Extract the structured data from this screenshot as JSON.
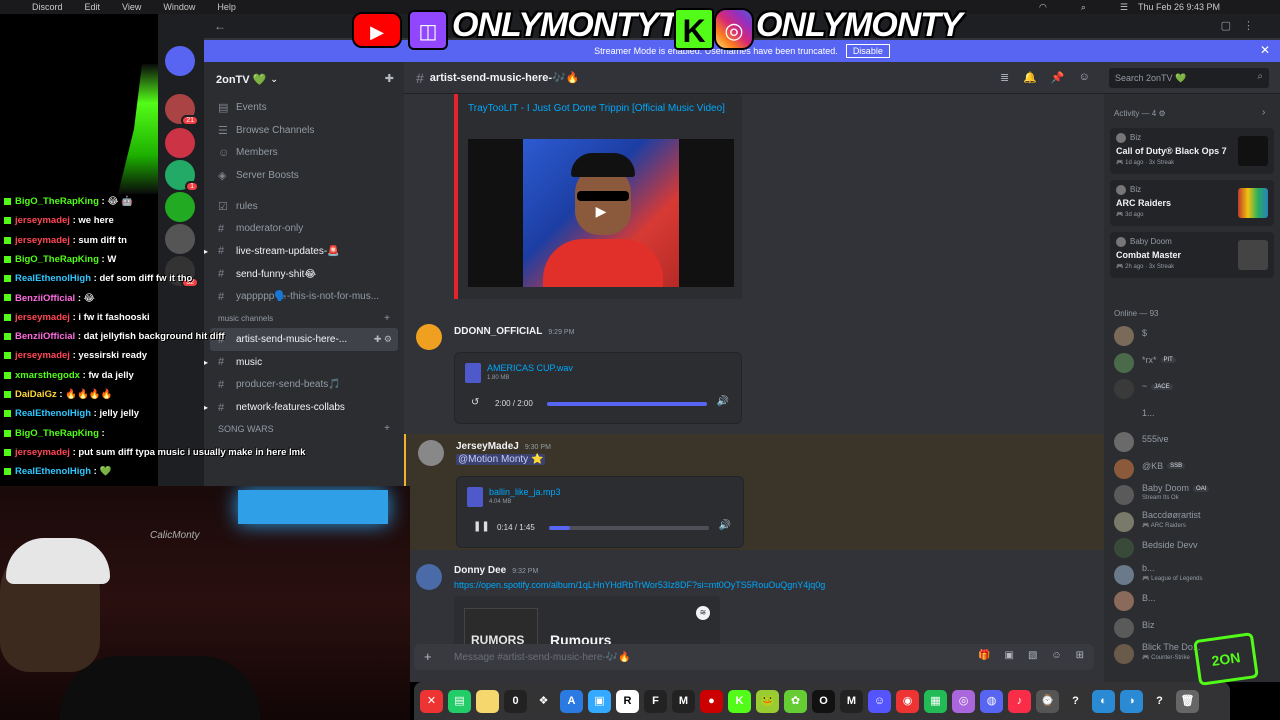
{
  "menubar": {
    "items": [
      "Discord",
      "Edit",
      "View",
      "Window",
      "Help"
    ],
    "clock": "Thu Feb 26  9:43 PM"
  },
  "banner": {
    "text": "Streamer Mode is enabled. Usernames have been truncated.",
    "disable_label": "Disable"
  },
  "server": {
    "name": "2onTV 💚",
    "rail_badges": [
      "21",
      "1",
      "32"
    ]
  },
  "sidebar": {
    "top_items": [
      {
        "label": "Events",
        "icon": "calendar-icon"
      },
      {
        "label": "Browse Channels",
        "icon": "browse-icon"
      },
      {
        "label": "Members",
        "icon": "members-icon"
      },
      {
        "label": "Server Boosts",
        "icon": "boost-icon"
      }
    ],
    "channels": [
      {
        "label": "rules",
        "state": "muted"
      },
      {
        "label": "moderator-only",
        "state": "muted"
      },
      {
        "label": "live-stream-updates-🚨",
        "state": "unread"
      },
      {
        "label": "send-funny-shit😂",
        "state": "unread"
      },
      {
        "label": "yappppp🗣️-this-is-not-for-mus...",
        "state": "muted"
      }
    ],
    "category_label": "music channels",
    "channels2": [
      {
        "label": "artist-send-music-here-...",
        "state": "active"
      },
      {
        "label": "music",
        "state": "unread"
      },
      {
        "label": "producer-send-beats🎵",
        "state": "muted"
      },
      {
        "label": "network-features-collabs",
        "state": "unread"
      }
    ],
    "bottom_label": "SONG WARS"
  },
  "channel_header": {
    "title": "artist-send-music-here-🎶🔥",
    "search_placeholder": "Search 2onTV 💚"
  },
  "messages": {
    "embed": {
      "title": "TrayTooLIT - I Just Got Done Trippin [Official Music Video]"
    },
    "msg1": {
      "author": "DDONN_OFFICIAL",
      "time": "9:29 PM",
      "file": "AMERICAS CUP.wav",
      "size": "1.80 MB",
      "duration": "2:00 / 2:00",
      "progress": 1.0
    },
    "msg2": {
      "author": "JerseyMadeJ",
      "time": "9:30 PM",
      "mention": "@Motion Monty ⭐",
      "file": "ballin_like_ja.mp3",
      "size": "4.04 MB",
      "duration": "0:14 / 1:45",
      "progress": 0.13
    },
    "msg3": {
      "author": "Donny Dee",
      "time": "9:32 PM",
      "link": "https://open.spotify.com/album/1qLHnYHdRbTrWor53Iz8DF?si=mt0OyTS5RouOuQgnY4jq0g",
      "album_art_text": "RUMORS",
      "album_title": "Rumours"
    }
  },
  "composer": {
    "placeholder": "Message #artist-send-music-here-🎶🔥"
  },
  "activity": {
    "header": "Activity — 4",
    "cards": [
      {
        "who": "Biz",
        "game": "Call of Duty® Black Ops 7",
        "meta": "🎮 1d ago · 3x Streak",
        "art_color": "#111111"
      },
      {
        "who": "Biz",
        "game": "ARC Raiders",
        "meta": "🎮 3d ago",
        "art_color": "#c0392b"
      },
      {
        "who": "Baby Doom",
        "game": "Combat Master",
        "meta": "🎮 2h ago · 3x Streak",
        "art_color": "#444444"
      }
    ]
  },
  "online": {
    "header": "Online — 93",
    "members": [
      {
        "name": "$",
        "sub": "",
        "tag": "",
        "color": "#7a6a5a"
      },
      {
        "name": "*rx*",
        "sub": "",
        "tag": "PIT",
        "color": "#4a6a4a"
      },
      {
        "name": "~",
        "sub": "",
        "tag": "JACE",
        "color": "#3a3a3a"
      },
      {
        "name": "1...",
        "sub": "",
        "tag": "",
        "color": "#2b2d31"
      },
      {
        "name": "555ive",
        "sub": "",
        "tag": "",
        "color": "#6a6a6a"
      },
      {
        "name": "@KB",
        "sub": "",
        "tag": "SSB",
        "color": "#8a5a3a"
      },
      {
        "name": "Baby Doom",
        "sub": "Stream Its Ok",
        "tag": "OAI",
        "color": "#5a5a5a"
      },
      {
        "name": "Baccdøøṛartist",
        "sub": "🎮 ARC Raiders",
        "tag": "",
        "color": "#7a7a6a"
      },
      {
        "name": "Bedside Devv",
        "sub": "",
        "tag": "",
        "color": "#3a4a3a"
      },
      {
        "name": "b...",
        "sub": "🎮 League of Legends",
        "tag": "",
        "color": "#6a7a8a"
      },
      {
        "name": "B...",
        "sub": "",
        "tag": "",
        "color": "#8a6a5a"
      },
      {
        "name": "Biz",
        "sub": "",
        "tag": "",
        "color": "#5a5a5a"
      },
      {
        "name": "Blick The Do...",
        "sub": "🎮 Counter-Strike",
        "tag": "",
        "color": "#6a5a4a"
      }
    ]
  },
  "stream_chat": [
    {
      "user": "BigO_TheRapKing",
      "text": ": 😂 🤖",
      "color": "green"
    },
    {
      "user": "jerseymadej",
      "text": ": we here",
      "color": "red"
    },
    {
      "user": "jerseymadej",
      "text": ": sum diff tn",
      "color": "red"
    },
    {
      "user": "BigO_TheRapKing",
      "text": ": W",
      "color": "green"
    },
    {
      "user": "RealEthenolHigh",
      "text": ": def som diff fw it tho",
      "color": "cyan"
    },
    {
      "user": "BenziiOfficial",
      "text": ": 😂",
      "color": "pink"
    },
    {
      "user": "jerseymadej",
      "text": ": i fw it fashooski",
      "color": "red"
    },
    {
      "user": "BenziiOfficial",
      "text": ": dat jellyfish background hit diff",
      "color": "pink"
    },
    {
      "user": "jerseymadej",
      "text": ": yessirski ready",
      "color": "red"
    },
    {
      "user": "xmarsthegodx",
      "text": ": fw da jelly",
      "color": "green"
    },
    {
      "user": "DaiDaiGz",
      "text": ": 🔥🔥🔥🔥",
      "color": "yellow"
    },
    {
      "user": "RealEthenolHigh",
      "text": ": jelly jelly",
      "color": "cyan"
    },
    {
      "user": "BigO_TheRapKing",
      "text": ":",
      "color": "green"
    },
    {
      "user": "jerseymadej",
      "text": ": put sum diff typa music i usually make in here lmk",
      "color": "red"
    },
    {
      "user": "RealEthenolHigh",
      "text": ": 💚",
      "color": "cyan"
    }
  ],
  "overlay": {
    "handle_1": "ONLYMONTYTV",
    "handle_2": "ONLYMONTY",
    "webcam_wall_logo": "CalicMonty",
    "watermark": "2ON"
  },
  "dock": [
    "✕",
    "▤",
    "",
    "0",
    "❖",
    "A",
    "▣",
    "R",
    "F",
    "M",
    "●",
    "K",
    "🐸",
    "✿",
    "O",
    "M",
    "☺",
    "◉",
    "▦",
    "◎",
    "◍",
    "♪",
    "⌚",
    "?",
    "◐",
    "◑",
    "?",
    "🗑"
  ],
  "colors": {
    "accent": "#5865f2",
    "kick_green": "#53fc18",
    "link": "#00a8fc"
  }
}
